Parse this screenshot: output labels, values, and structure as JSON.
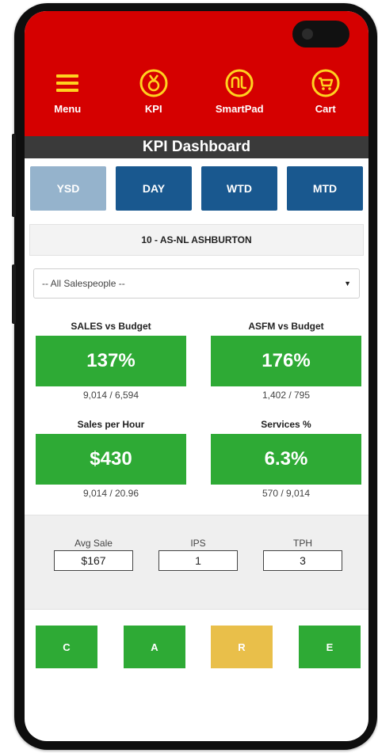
{
  "nav": [
    {
      "label": "Menu",
      "icon": "menu-icon"
    },
    {
      "label": "KPI",
      "icon": "medal-icon"
    },
    {
      "label": "SmartPad",
      "icon": "smartpad-logo-icon"
    },
    {
      "label": "Cart",
      "icon": "cart-icon"
    }
  ],
  "title": "KPI Dashboard",
  "tabs": [
    "YSD",
    "DAY",
    "WTD",
    "MTD"
  ],
  "active_tab": "YSD",
  "store": "10 - AS-NL ASHBURTON",
  "salesperson": "-- All Salespeople --",
  "kpis": [
    {
      "title": "SALES vs Budget",
      "value": "137%",
      "sub": "9,014 / 6,594"
    },
    {
      "title": "ASFM vs Budget",
      "value": "176%",
      "sub": "1,402 / 795"
    },
    {
      "title": "Sales per Hour",
      "value": "$430",
      "sub": "9,014 / 20.96"
    },
    {
      "title": "Services %",
      "value": "6.3%",
      "sub": "570 / 9,014"
    }
  ],
  "stats": [
    {
      "label": "Avg Sale",
      "value": "$167"
    },
    {
      "label": "IPS",
      "value": "1"
    },
    {
      "label": "TPH",
      "value": "3"
    }
  ],
  "care_buttons": [
    {
      "label": "C",
      "status": "green"
    },
    {
      "label": "A",
      "status": "green"
    },
    {
      "label": "R",
      "status": "yellow"
    },
    {
      "label": "E",
      "status": "green"
    }
  ],
  "colors": {
    "header_red": "#d50000",
    "icon_yellow": "#ffd21f",
    "tab_blue": "#19588f",
    "tab_active": "#95b3cc",
    "kpi_green": "#2eaa35",
    "care_yellow": "#e9bf4a",
    "title_bar": "#3a3a3a"
  }
}
